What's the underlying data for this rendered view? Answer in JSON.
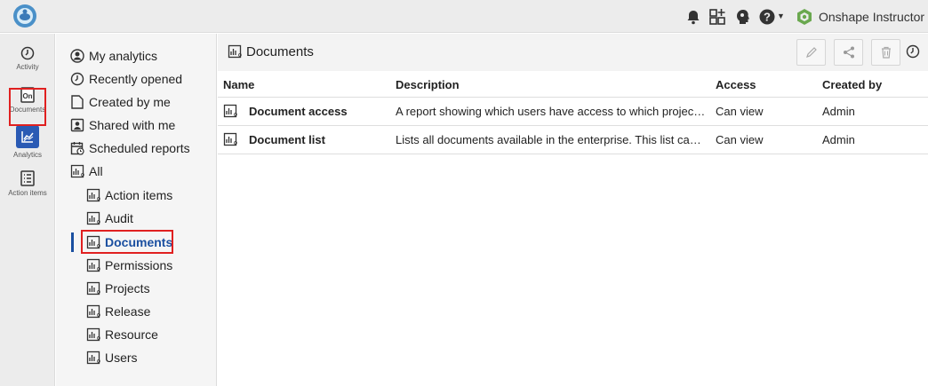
{
  "topbar": {
    "user_name": "Onshape Instructor",
    "icons": [
      "app-logo-icon",
      "bell-icon",
      "app-store-icon",
      "learning-icon",
      "help-icon",
      "org-logo-icon"
    ]
  },
  "rail": {
    "items": [
      {
        "label": "Activity",
        "icon": "clock-icon"
      },
      {
        "label": "Documents",
        "icon": "documents-icon"
      },
      {
        "label": "Analytics",
        "icon": "chart-icon",
        "active": true
      },
      {
        "label": "Action items",
        "icon": "checklist-icon"
      }
    ]
  },
  "nav": {
    "items": [
      {
        "label": "My analytics",
        "icon": "user-circle-icon"
      },
      {
        "label": "Recently opened",
        "icon": "clock-icon"
      },
      {
        "label": "Created by me",
        "icon": "document-icon"
      },
      {
        "label": "Shared with me",
        "icon": "shared-user-icon"
      },
      {
        "label": "Scheduled reports",
        "icon": "calendar-icon"
      },
      {
        "label": "All",
        "icon": "report-icon"
      },
      {
        "label": "Action items",
        "icon": "report-icon"
      },
      {
        "label": "Audit",
        "icon": "report-icon"
      },
      {
        "label": "Documents",
        "icon": "report-icon",
        "active": true
      },
      {
        "label": "Permissions",
        "icon": "report-icon"
      },
      {
        "label": "Projects",
        "icon": "report-icon"
      },
      {
        "label": "Release",
        "icon": "report-icon"
      },
      {
        "label": "Resource",
        "icon": "report-icon"
      },
      {
        "label": "Users",
        "icon": "report-icon"
      }
    ]
  },
  "main": {
    "title": "Documents",
    "toolbar": [
      "edit-icon",
      "share-icon",
      "trash-icon",
      "history-icon"
    ],
    "columns": {
      "name": "Name",
      "description": "Description",
      "access": "Access",
      "created_by": "Created by"
    },
    "rows": [
      {
        "name": "Document access",
        "description": "A report showing which users have access to which projects an...",
        "access": "Can view",
        "created_by": "Admin"
      },
      {
        "name": "Document list",
        "description": "Lists all documents available in the enterprise. This list can be ...",
        "access": "Can view",
        "created_by": "Admin"
      }
    ]
  },
  "colors": {
    "accent": "#1a4fa0",
    "rail_active": "#2a5ab4",
    "highlight": "#e02020",
    "onshape_green": "#6aa84f"
  }
}
